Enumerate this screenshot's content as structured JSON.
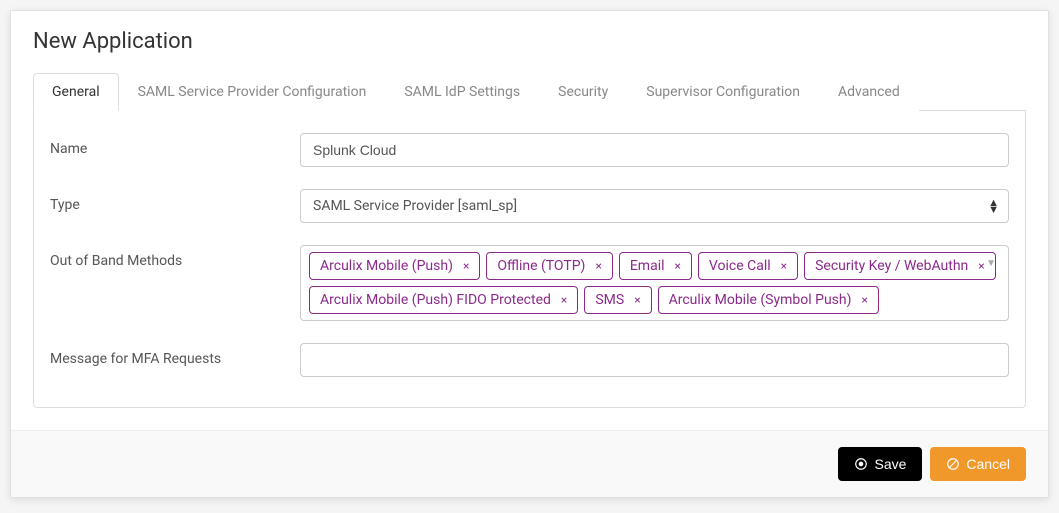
{
  "page": {
    "title": "New Application"
  },
  "tabs": {
    "general": "General",
    "saml_sp_config": "SAML Service Provider Configuration",
    "saml_idp": "SAML IdP Settings",
    "security": "Security",
    "supervisor": "Supervisor Configuration",
    "advanced": "Advanced"
  },
  "fields": {
    "name": {
      "label": "Name",
      "value": "Splunk Cloud"
    },
    "type": {
      "label": "Type",
      "value": "SAML Service Provider [saml_sp]"
    },
    "oob": {
      "label": "Out of Band Methods",
      "tags": [
        "Arculix Mobile (Push)",
        "Offline (TOTP)",
        "Email",
        "Voice Call",
        "Security Key / WebAuthn",
        "Arculix Mobile (Push) FIDO Protected",
        "SMS",
        "Arculix Mobile (Symbol Push)"
      ]
    },
    "mfa_message": {
      "label": "Message for MFA Requests",
      "value": ""
    }
  },
  "actions": {
    "save": "Save",
    "cancel": "Cancel"
  }
}
